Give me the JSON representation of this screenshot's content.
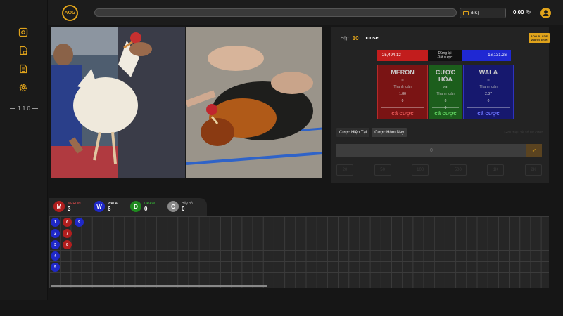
{
  "topbar": {
    "logo": "AOG",
    "wallet_label": "đ(K)",
    "balance": "0.00"
  },
  "sidebar": {
    "version": "1.1.0",
    "items": [
      {
        "icon": "settings-gear-box-icon"
      },
      {
        "icon": "wallet-doc-icon"
      },
      {
        "icon": "document-list-icon"
      },
      {
        "icon": "gear-icon"
      }
    ]
  },
  "round": {
    "label": "Hộp:",
    "number": "10",
    "status": "close"
  },
  "badge": {
    "line1": "AOG BLADE",
    "line2": "vào trò chơi"
  },
  "totals": {
    "meron": "25,494.12",
    "mid_line1": "Dừng lại",
    "mid_line2": "Đặt cược",
    "wala": "16,131.26"
  },
  "bets": {
    "meron": {
      "name": "MERON",
      "amount": "0",
      "payout_label": "Thanh toán",
      "odds": "1.80",
      "mine": "0",
      "cta": "cá cược"
    },
    "draw": {
      "name": "CƯỢC HÒA",
      "amount": "200",
      "payout_label": "Thanh toán",
      "odds": "8",
      "mine": "0",
      "cta": "cá cược"
    },
    "wala": {
      "name": "WALA",
      "amount": "0",
      "payout_label": "Thanh toán",
      "odds": "2.37",
      "mine": "0",
      "cta": "cá cược"
    }
  },
  "tabs": [
    "Cược Hiện Tại",
    "Cược Hôm Nay"
  ],
  "hint": "Giới thiệu về số dư cược",
  "amount_value": "0",
  "chips": [
    "20",
    "50",
    "100",
    "500",
    "1K",
    "2K"
  ],
  "results": {
    "legend": [
      {
        "letter": "M",
        "name": "MERON",
        "count": "3",
        "color": "#b21e1e",
        "name_color": "#e24b4b"
      },
      {
        "letter": "W",
        "name": "WALA",
        "count": "6",
        "color": "#1f28c8",
        "name_color": "#ffffff"
      },
      {
        "letter": "D",
        "name": "DRAW",
        "count": "0",
        "color": "#1f8a1f",
        "name_color": "#37c137"
      },
      {
        "letter": "C",
        "name": "Hủy bỏ",
        "count": "0",
        "color": "#888888",
        "name_color": "#bbbbbb"
      }
    ],
    "cols": [
      [
        {
          "n": "1",
          "c": "blue"
        },
        {
          "n": "2",
          "c": "blue"
        },
        {
          "n": "3",
          "c": "blue"
        },
        {
          "n": "4",
          "c": "blue"
        },
        {
          "n": "5",
          "c": "blue"
        }
      ],
      [
        {
          "n": "6",
          "c": "red"
        },
        {
          "n": "7",
          "c": "red"
        },
        {
          "n": "8",
          "c": "red"
        }
      ],
      [
        {
          "n": "9",
          "c": "blue"
        }
      ]
    ]
  }
}
